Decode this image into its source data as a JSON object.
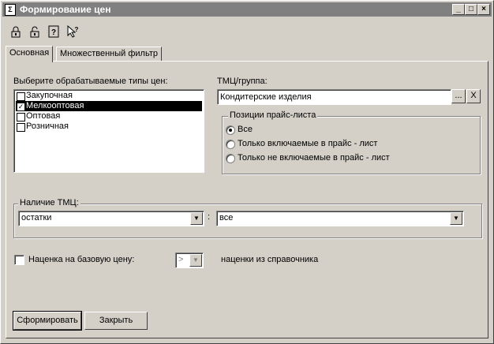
{
  "window": {
    "title": "Формирование цен",
    "icon": "app-icon"
  },
  "titlebar_buttons": {
    "minimize": "_",
    "maximize": "□",
    "close": "×"
  },
  "toolbar": [
    "tool-lock-icon",
    "tool-unlock-icon",
    "help-icon",
    "whats-this-icon"
  ],
  "tabs": [
    {
      "label": "Основная"
    },
    {
      "label": "Множественный фильтр"
    }
  ],
  "price_types": {
    "label": "Выберите обрабатываемые типы цен:",
    "items": [
      {
        "label": "Закупочная",
        "checked": false
      },
      {
        "label": "Мелкооптовая",
        "checked": true
      },
      {
        "label": "Оптовая",
        "checked": false
      },
      {
        "label": "Розничная",
        "checked": false
      }
    ]
  },
  "tmc_group": {
    "label": "ТМЦ/группа:",
    "value": "Кондитерские изделия",
    "browse": "...",
    "clear": "X"
  },
  "price_list": {
    "label": "Позиции прайс-листа",
    "options": [
      {
        "label": "Все",
        "selected": true
      },
      {
        "label": "Только включаемые в прайс - лист",
        "selected": false
      },
      {
        "label": "Только не включаемые в прайс - лист",
        "selected": false
      }
    ]
  },
  "availability": {
    "label": "Наличие ТМЦ:",
    "left_value": "остатки",
    "separator": ":",
    "right_value": "все"
  },
  "markup": {
    "checkbox_label": "Наценка на базовую цену:",
    "checked": false,
    "op_value": ">",
    "hint": "наценки из справочника"
  },
  "buttons": {
    "form": "Сформировать",
    "close": "Закрыть"
  }
}
